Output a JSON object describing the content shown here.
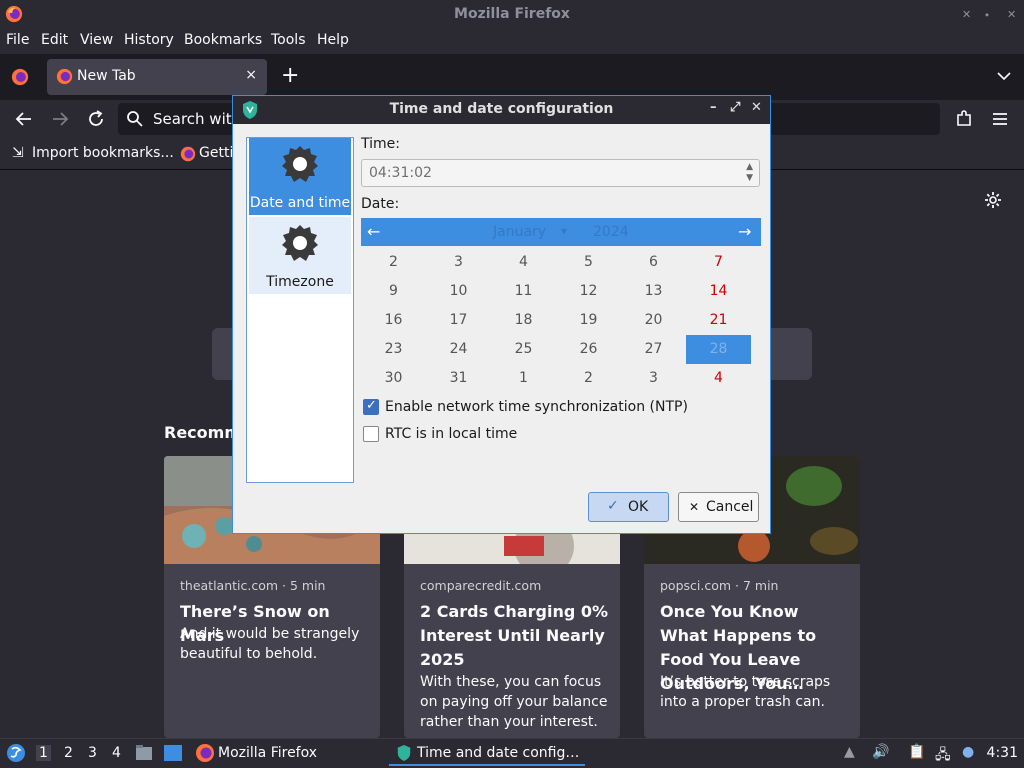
{
  "window": {
    "title": "Mozilla Firefox"
  },
  "menubar": {
    "items": [
      "File",
      "Edit",
      "View",
      "History",
      "Bookmarks",
      "Tools",
      "Help"
    ]
  },
  "tabs": [
    {
      "label": "New Tab",
      "close": "×"
    }
  ],
  "toolbar": {
    "new_tab": "+",
    "url_placeholder": "Search with"
  },
  "bookmarks": {
    "items": [
      "Import bookmarks...",
      "Getti"
    ]
  },
  "newtab_page": {
    "recommended_label": "Recomm",
    "cards": [
      {
        "source": "theatlantic.com · 5 min",
        "title": "There’s Snow on Mars",
        "excerpt": "And it would be strangely beautiful to behold."
      },
      {
        "source": "comparecredit.com",
        "title": "2 Cards Charging 0% Interest Until Nearly 2025",
        "excerpt": "With these, you can focus on paying off your balance rather than your interest."
      },
      {
        "source": "popsci.com · 7 min",
        "title": "Once You Know What Happens to Food You Leave Outdoors, You…",
        "excerpt": "It’s better to toss scraps into a proper trash can."
      }
    ]
  },
  "dialog": {
    "title": "Time and date configuration",
    "controls": {
      "minimize": "–",
      "maximize": "⤢",
      "close": "✕"
    },
    "sidebar": [
      {
        "label": "Date and time",
        "active": true
      },
      {
        "label": "Timezone",
        "active": false
      }
    ],
    "time_label": "Time:",
    "time_value": "04:31:02",
    "date_label": "Date:",
    "calendar": {
      "month": "January",
      "month_dropdown": "▾",
      "year": "2024",
      "prev": "←",
      "next": "→",
      "rows": [
        [
          "2",
          "3",
          "4",
          "5",
          "6",
          "7"
        ],
        [
          "9",
          "10",
          "11",
          "12",
          "13",
          "14"
        ],
        [
          "16",
          "17",
          "18",
          "19",
          "20",
          "21"
        ],
        [
          "23",
          "24",
          "25",
          "26",
          "27",
          "28"
        ],
        [
          "30",
          "31",
          "1",
          "2",
          "3",
          "4"
        ]
      ],
      "selected": "28"
    },
    "ntp": {
      "label": "Enable network time synchronization (NTP)",
      "checked": true
    },
    "rtc": {
      "label": "RTC is in local time",
      "checked": false
    },
    "ok": {
      "label": "OK",
      "icon": "✓"
    },
    "cancel": {
      "label": "Cancel",
      "icon": "✕"
    }
  },
  "taskbar": {
    "workspaces": [
      "1",
      "2",
      "3",
      "4"
    ],
    "tasks": [
      {
        "label": "Mozilla Firefox"
      },
      {
        "label": "Time and date config…"
      }
    ],
    "clock": "4:31"
  },
  "colors": {
    "accent": "#3d8ee0",
    "sunday": "#cc0000",
    "firefox_dark": "#1c1b22",
    "firefox_panel": "#2b2a33"
  }
}
